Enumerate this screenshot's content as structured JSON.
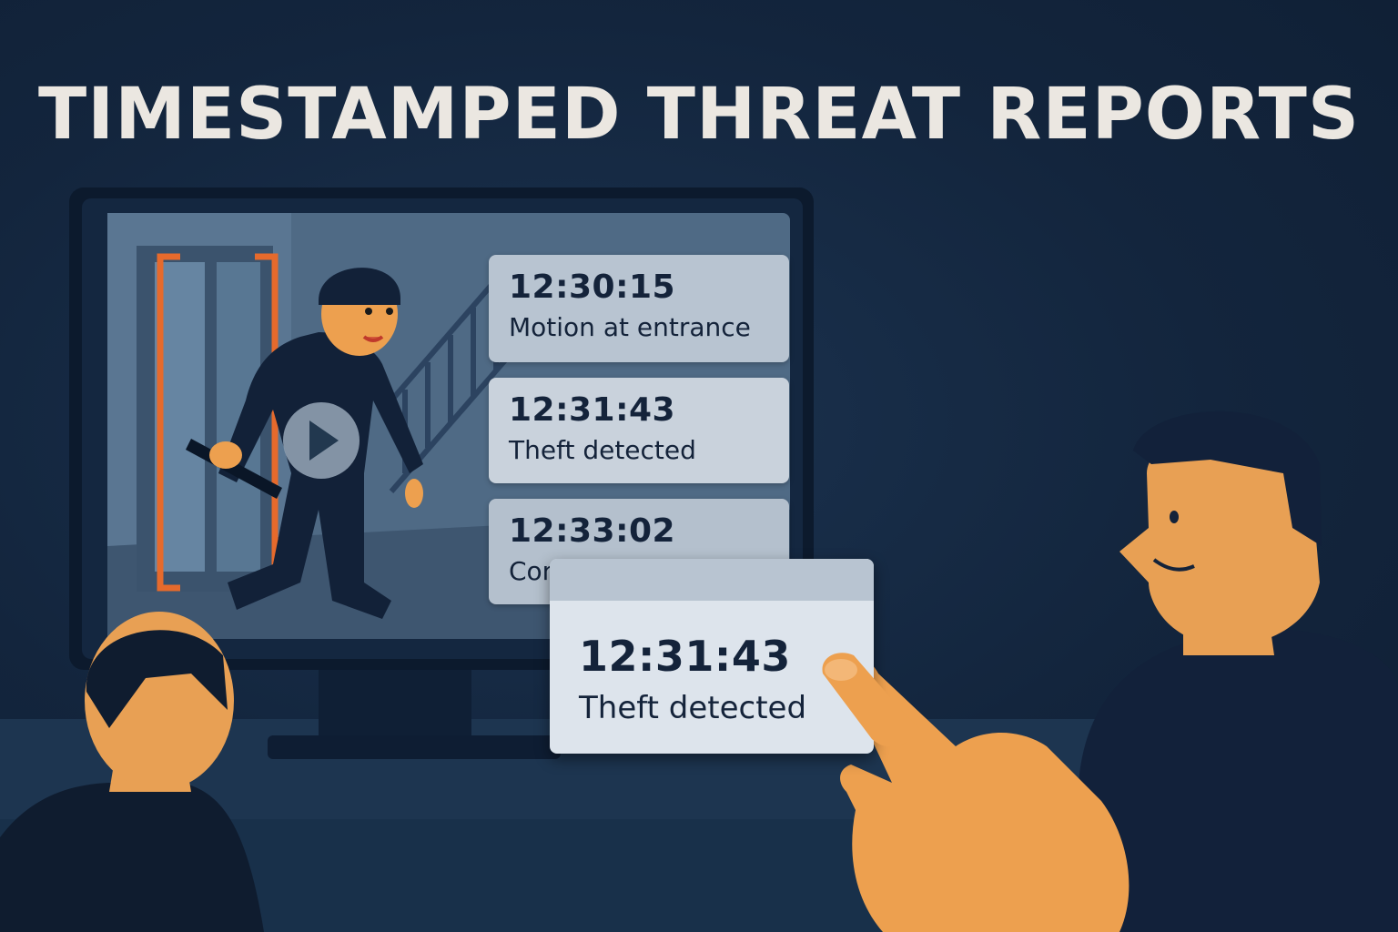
{
  "headline": "TIMESTAMPED THREAT REPORTS",
  "events": [
    {
      "time": "12:30:15",
      "label": "Motion at entrance"
    },
    {
      "time": "12:31:43",
      "label": "Theft detected"
    },
    {
      "time": "12:33:02",
      "label": "Compliance violation"
    }
  ],
  "popup": {
    "time": "12:31:43",
    "label": "Theft detected"
  },
  "colors": {
    "background": "#13253d",
    "headline": "#ebe7e1",
    "card": "#bac6d3",
    "popup": "#dde4ec",
    "text_dark": "#14233a",
    "accent_orange": "#e66a2c",
    "skin": "#eda04f"
  },
  "icons": {
    "play": "play-icon"
  }
}
